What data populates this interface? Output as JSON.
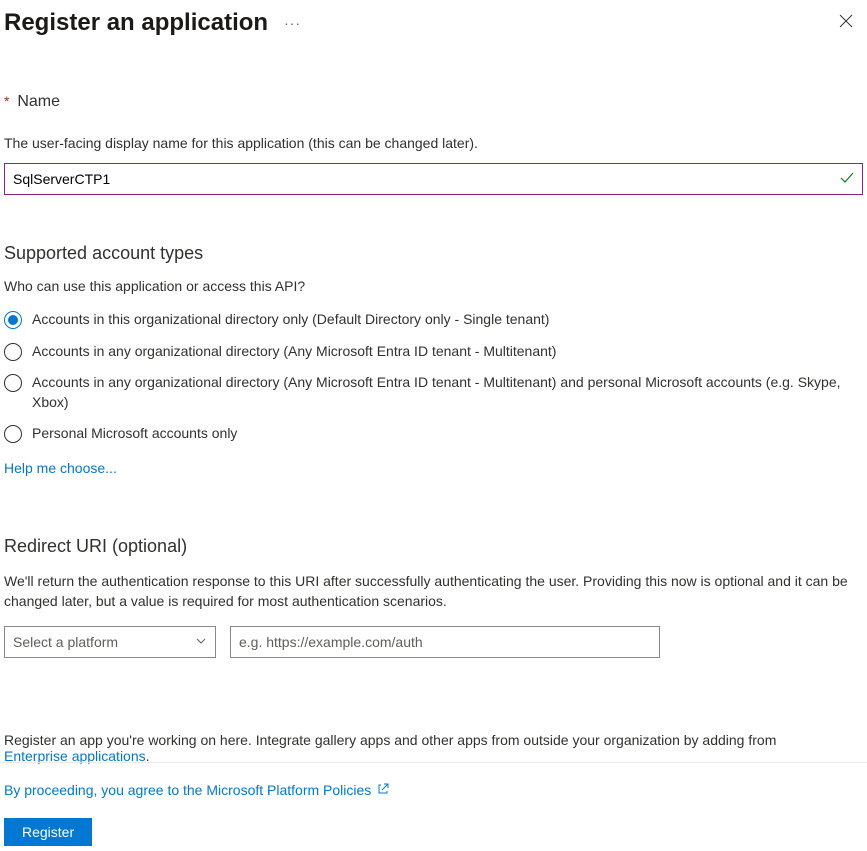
{
  "header": {
    "title": "Register an application"
  },
  "name_section": {
    "label": "Name",
    "description": "The user-facing display name for this application (this can be changed later).",
    "value": "SqlServerCTP1"
  },
  "account_types": {
    "heading": "Supported account types",
    "sub": "Who can use this application or access this API?",
    "options": [
      "Accounts in this organizational directory only (Default Directory only - Single tenant)",
      "Accounts in any organizational directory (Any Microsoft Entra ID tenant - Multitenant)",
      "Accounts in any organizational directory (Any Microsoft Entra ID tenant - Multitenant) and personal Microsoft accounts (e.g. Skype, Xbox)",
      "Personal Microsoft accounts only"
    ],
    "selected_index": 0,
    "help_link": "Help me choose..."
  },
  "redirect": {
    "heading": "Redirect URI (optional)",
    "description": "We'll return the authentication response to this URI after successfully authenticating the user. Providing this now is optional and it can be changed later, but a value is required for most authentication scenarios.",
    "platform_placeholder": "Select a platform",
    "uri_placeholder": "e.g. https://example.com/auth"
  },
  "footer": {
    "note_prefix": "Register an app you're working on here. Integrate gallery apps and other apps from outside your organization by adding from ",
    "note_link": "Enterprise applications",
    "note_suffix": ".",
    "proceed_text": "By proceeding, you agree to the Microsoft Platform Policies",
    "register_label": "Register"
  }
}
